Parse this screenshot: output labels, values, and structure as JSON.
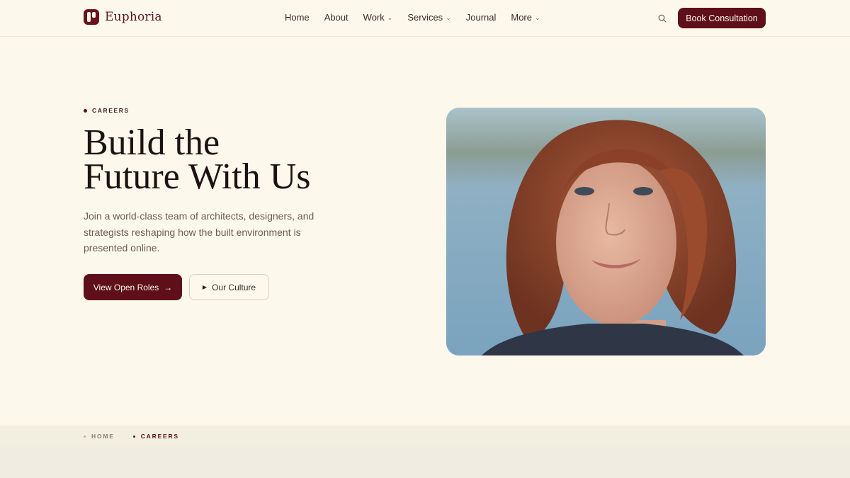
{
  "brand": {
    "name": "Euphoria",
    "accent": "#5e0f1a"
  },
  "nav": {
    "items": [
      {
        "label": "Home",
        "has_dropdown": false
      },
      {
        "label": "About",
        "has_dropdown": false
      },
      {
        "label": "Work",
        "has_dropdown": true
      },
      {
        "label": "Services",
        "has_dropdown": true
      },
      {
        "label": "Journal",
        "has_dropdown": false
      },
      {
        "label": "More",
        "has_dropdown": true
      }
    ],
    "search_icon": "search-icon",
    "cta_label": "Book Consultation"
  },
  "hero": {
    "eyebrow": "CAREERS",
    "title_line1": "Build the",
    "title_line2": "Future With Us",
    "description": "Join a world-class team of architects, designers, and strategists reshaping how the built environment is presented online.",
    "primary_button": "View Open Roles",
    "primary_icon": "arrow-right-icon",
    "secondary_button": "Our Culture",
    "secondary_icon": "play-icon",
    "image_subject": "portrait-photo"
  },
  "breadcrumb": {
    "items": [
      "HOME",
      "CAREERS"
    ]
  }
}
